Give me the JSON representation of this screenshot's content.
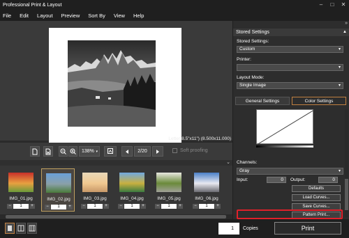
{
  "window": {
    "title": "Professional Print & Layout",
    "controls": [
      "–",
      "□",
      "✕"
    ]
  },
  "menu": [
    "File",
    "Edit",
    "Layout",
    "Preview",
    "Sort By",
    "View",
    "Help"
  ],
  "preview": {
    "paper_size": "Letter(8.5\"x11\") (8.500x11.000)"
  },
  "toolbar": {
    "zoom_value": "138%",
    "page_indicator": "2/20",
    "soft_proofing_label": "Soft proofing",
    "soft_proofing_checked": false
  },
  "thumbnails": [
    {
      "name": "IMG_01.jpg",
      "count": "1",
      "selected": false,
      "colors": [
        "#c8302a",
        "#e8a040",
        "#6a9a3a"
      ]
    },
    {
      "name": "IMG_02.jpg",
      "count": "1",
      "selected": true,
      "colors": [
        "#6aa0d8",
        "#8aa0a8",
        "#4a7a3a"
      ]
    },
    {
      "name": "IMG_03.jpg",
      "count": "1",
      "selected": false,
      "colors": [
        "#e8d8b8",
        "#f0c890",
        "#c89868"
      ]
    },
    {
      "name": "IMG_04.jpg",
      "count": "1",
      "selected": false,
      "colors": [
        "#70a8e0",
        "#c8b040",
        "#3a7a40"
      ]
    },
    {
      "name": "IMG_05.jpg",
      "count": "1",
      "selected": false,
      "colors": [
        "#e8e8e0",
        "#6a8a3a",
        "#a0a098"
      ]
    },
    {
      "name": "IMG_06.jpg",
      "count": "1",
      "selected": false,
      "colors": [
        "#4a80c8",
        "#e8e8f0",
        "#6a6a70"
      ]
    }
  ],
  "panel": {
    "collapse_glyph": "»",
    "section_title": "Stored Settings",
    "stored_settings_label": "Stored Settings:",
    "stored_settings_value": "Custom",
    "printer_label": "Printer:",
    "printer_value": "",
    "layout_mode_label": "Layout Mode:",
    "layout_mode_value": "Single Image",
    "tabs": [
      "General Settings",
      "Color Settings"
    ],
    "active_tab": 1,
    "channels_label": "Channels:",
    "channels_value": "Gray",
    "input_label": "Input:",
    "input_value": "0",
    "output_label": "Output:",
    "output_value": "0",
    "buttons": {
      "defaults": "Defaults",
      "load_curves": "Load Curves...",
      "save_curves": "Save Curves...",
      "pattern_print": "Pattern Print..."
    }
  },
  "bottom": {
    "copies_value": "1",
    "copies_label": "Copies",
    "print_label": "Print"
  },
  "accent": {
    "selection": "#c08040",
    "highlight": "#e0202a"
  }
}
